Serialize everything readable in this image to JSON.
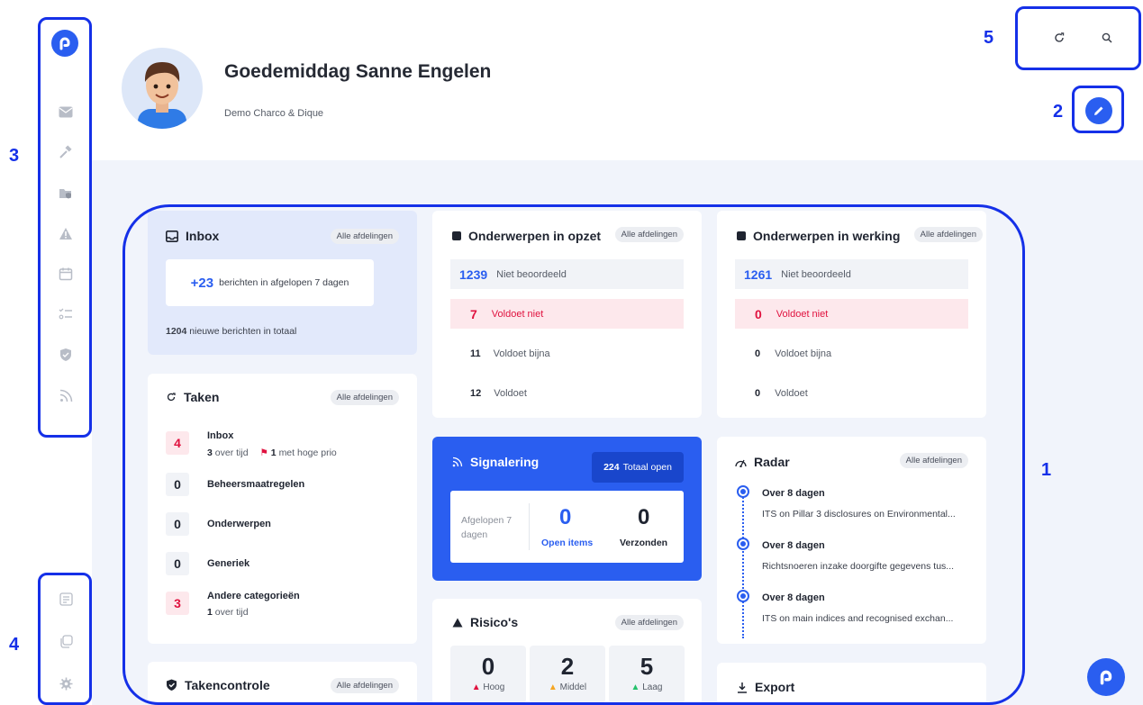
{
  "header": {
    "greeting": "Goedemiddag Sanne Engelen",
    "organization": "Demo Charco & Dique"
  },
  "annotations": [
    "1",
    "2",
    "3",
    "4",
    "5"
  ],
  "sidebar": {
    "top_icons": [
      "logo-icon",
      "mail-icon",
      "gavel-icon",
      "folder-shield-icon",
      "warning-icon",
      "calendar-icon",
      "checklist-icon",
      "shield-icon",
      "rss-icon"
    ],
    "bottom_icons": [
      "document-icon",
      "copy-icon",
      "settings-icon"
    ]
  },
  "topbar": {
    "icons": [
      "refresh-icon",
      "search-icon"
    ]
  },
  "colors": {
    "accent": "#2a5ef0",
    "danger": "#e0123f",
    "warn": "#f5a623",
    "ok": "#24c16b",
    "annotation": "#1530e8"
  },
  "inbox": {
    "title": "Inbox",
    "chip": "Alle afdelingen",
    "recent_count": "+23",
    "recent_text": "berichten in afgelopen 7 dagen",
    "total_count": "1204",
    "total_text": "nieuwe berichten in totaal"
  },
  "taken": {
    "title": "Taken",
    "chip": "Alle afdelingen",
    "items": [
      {
        "count": "4",
        "label": "Inbox",
        "overdue_count": "3",
        "overdue_text": "over tijd",
        "prio_count": "1",
        "prio_text": "met hoge prio"
      },
      {
        "count": "0",
        "label": "Beheersmaatregelen"
      },
      {
        "count": "0",
        "label": "Onderwerpen"
      },
      {
        "count": "0",
        "label": "Generiek"
      },
      {
        "count": "3",
        "label": "Andere categorieën",
        "overdue_count": "1",
        "overdue_text": "over tijd"
      }
    ]
  },
  "takencontrole": {
    "title": "Takencontrole",
    "chip": "Alle afdelingen"
  },
  "opzet": {
    "title": "Onderwerpen in opzet",
    "chip": "Alle afdelingen",
    "rows": [
      {
        "n": "1239",
        "label": "Niet beoordeeld"
      },
      {
        "n": "7",
        "label": "Voldoet niet"
      },
      {
        "n": "11",
        "label": "Voldoet bijna"
      },
      {
        "n": "12",
        "label": "Voldoet"
      }
    ]
  },
  "werking": {
    "title": "Onderwerpen in werking",
    "chip": "Alle afdelingen",
    "rows": [
      {
        "n": "1261",
        "label": "Niet beoordeeld"
      },
      {
        "n": "0",
        "label": "Voldoet niet"
      },
      {
        "n": "0",
        "label": "Voldoet bijna"
      },
      {
        "n": "0",
        "label": "Voldoet"
      }
    ]
  },
  "signalering": {
    "title": "Signalering",
    "total_count": "224",
    "total_text": "Totaal open",
    "period": "Afgelopen 7 dagen",
    "open_value": "0",
    "open_label": "Open items",
    "sent_value": "0",
    "sent_label": "Verzonden"
  },
  "risicos": {
    "title": "Risico's",
    "chip": "Alle afdelingen",
    "levels": [
      {
        "value": "0",
        "label": "Hoog"
      },
      {
        "value": "2",
        "label": "Middel"
      },
      {
        "value": "5",
        "label": "Laag"
      }
    ]
  },
  "radar": {
    "title": "Radar",
    "chip": "Alle afdelingen",
    "items": [
      {
        "when": "Over 8 dagen",
        "text": "ITS on Pillar 3 disclosures on Environmental..."
      },
      {
        "when": "Over 8 dagen",
        "text": "Richtsnoeren inzake doorgifte gegevens tus..."
      },
      {
        "when": "Over 8 dagen",
        "text": "ITS on main indices and recognised exchan..."
      }
    ]
  },
  "export": {
    "title": "Export"
  }
}
